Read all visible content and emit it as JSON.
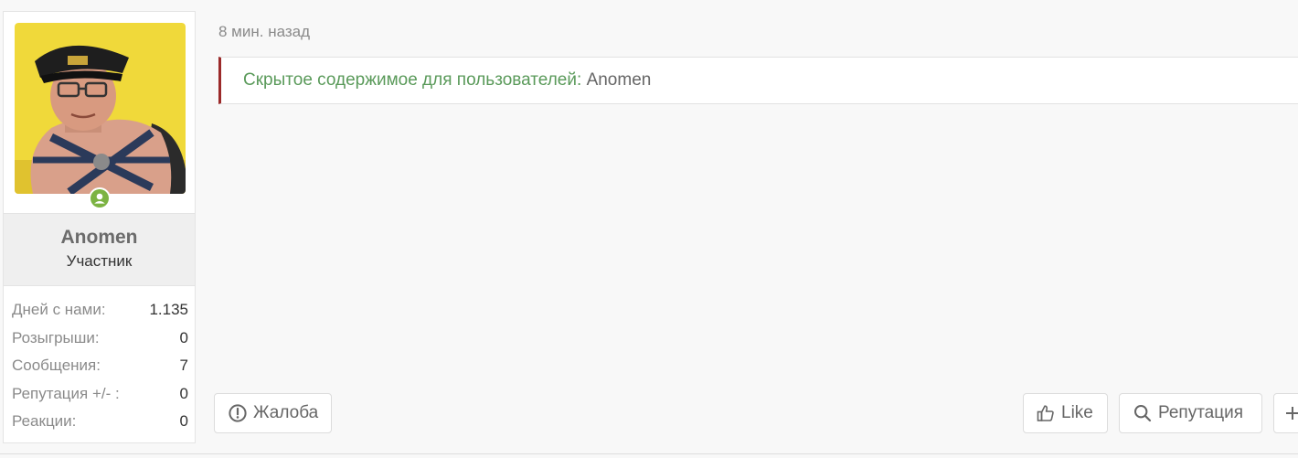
{
  "user": {
    "name": "Anomen",
    "title": "Участник",
    "online_color": "#7cb342",
    "stats": [
      {
        "label": "Дней с нами:",
        "value": "1.135"
      },
      {
        "label": "Розыгрыши:",
        "value": "0"
      },
      {
        "label": "Сообщения:",
        "value": "7"
      },
      {
        "label": "Репутация +/- :",
        "value": "0"
      },
      {
        "label": "Реакции:",
        "value": "0"
      }
    ]
  },
  "post": {
    "timestamp": "8 мин. назад",
    "hidden_label": "Скрытое содержимое для пользователей:",
    "hidden_user": "Anomen",
    "accent_color": "#9b2a2a"
  },
  "actions": {
    "report": {
      "label": "Жалоба",
      "icon": "exclamation-circle-icon"
    },
    "like": {
      "label": "Like",
      "icon": "thumbs-up-icon"
    },
    "reputation": {
      "label": "Репутация",
      "icon": "search-icon"
    },
    "more": {
      "icon": "plus-icon"
    }
  }
}
